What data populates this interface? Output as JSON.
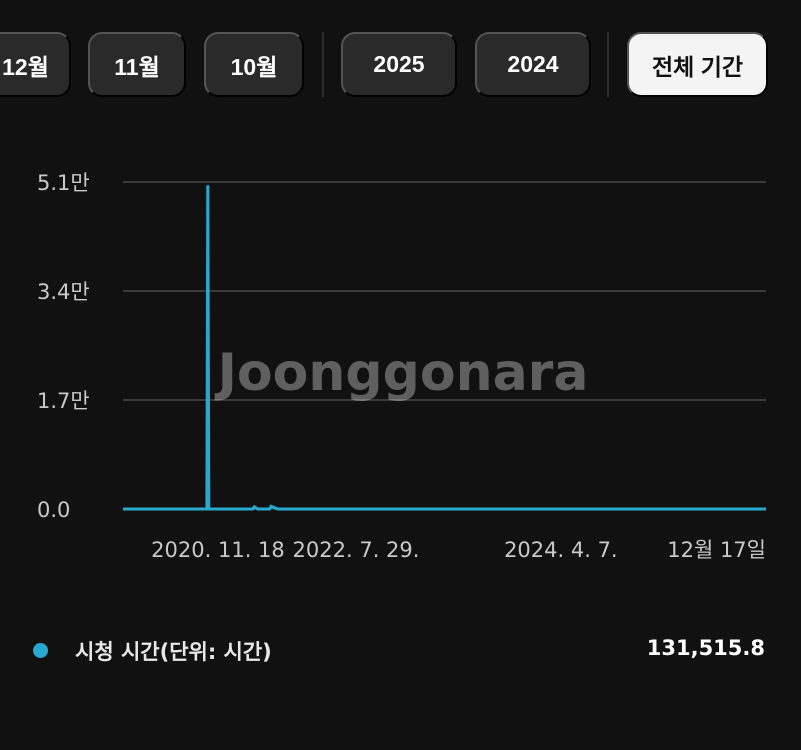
{
  "filters": {
    "month_dec": "12월",
    "month_nov": "11월",
    "month_oct": "10월",
    "year_2025": "2025",
    "year_2024": "2024",
    "all_period": "전체 기간"
  },
  "watermark": "Joonggonara",
  "colors": {
    "series": "#27a9cf",
    "grid": "#3a3a3b",
    "tick_text": "#c9c9c9"
  },
  "chart_data": {
    "type": "line",
    "y_tick_labels": [
      "0.0",
      "1.7만",
      "3.4만",
      "5.1만"
    ],
    "y_ticks": [
      0,
      17000,
      34000,
      51000
    ],
    "ylim": [
      0,
      51000
    ],
    "x_tick_labels": [
      "2020. 11. 18",
      "2022. 7. 29.",
      "2024. 4. 7.",
      "12월 17일"
    ],
    "x_ticks": [
      "2020-11-18",
      "2022-07-29",
      "2024-04-07",
      "2025-12-17"
    ],
    "xlim": [
      "2020-08-25",
      "2025-12-17"
    ],
    "grid": true,
    "series": [
      {
        "name": "시청 시간(단위: 시간)",
        "points": [
          [
            "2020-08-25",
            0
          ],
          [
            "2021-05-05",
            0
          ],
          [
            "2021-05-08",
            50500
          ],
          [
            "2021-05-11",
            0
          ],
          [
            "2021-09-20",
            0
          ],
          [
            "2021-09-25",
            350
          ],
          [
            "2021-10-05",
            0
          ],
          [
            "2021-11-10",
            0
          ],
          [
            "2021-11-15",
            400
          ],
          [
            "2021-12-05",
            0
          ],
          [
            "2025-12-17",
            0
          ]
        ]
      }
    ]
  },
  "legend": {
    "label": "시청 시간(단위: 시간)",
    "total": "131,515.8"
  }
}
